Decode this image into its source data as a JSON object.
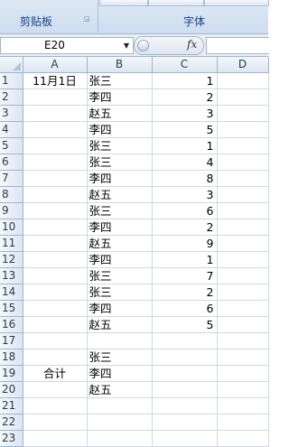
{
  "ribbon": {
    "clipboard_label": "剪贴板",
    "font_label": "字体",
    "launcher_icon": "dialog-launcher-icon"
  },
  "formula_bar": {
    "name_box": "E20",
    "fx_label": "fx",
    "formula": ""
  },
  "sheet": {
    "columns": [
      "A",
      "B",
      "C",
      "D"
    ],
    "rows": [
      {
        "n": "1",
        "a": "11月1日",
        "b": "张三",
        "c": "1"
      },
      {
        "n": "2",
        "a": "",
        "b": "李四",
        "c": "2"
      },
      {
        "n": "3",
        "a": "",
        "b": "赵五",
        "c": "3"
      },
      {
        "n": "4",
        "a": "",
        "b": "李四",
        "c": "5"
      },
      {
        "n": "5",
        "a": "",
        "b": "张三",
        "c": "1"
      },
      {
        "n": "6",
        "a": "",
        "b": "张三",
        "c": "4"
      },
      {
        "n": "7",
        "a": "",
        "b": "李四",
        "c": "8"
      },
      {
        "n": "8",
        "a": "",
        "b": "赵五",
        "c": "3"
      },
      {
        "n": "9",
        "a": "",
        "b": "张三",
        "c": "6"
      },
      {
        "n": "10",
        "a": "",
        "b": "李四",
        "c": "2"
      },
      {
        "n": "11",
        "a": "",
        "b": "赵五",
        "c": "9"
      },
      {
        "n": "12",
        "a": "",
        "b": "李四",
        "c": "1"
      },
      {
        "n": "13",
        "a": "",
        "b": "张三",
        "c": "7"
      },
      {
        "n": "14",
        "a": "",
        "b": "张三",
        "c": "2"
      },
      {
        "n": "15",
        "a": "",
        "b": "李四",
        "c": "6"
      },
      {
        "n": "16",
        "a": "",
        "b": "赵五",
        "c": "5"
      },
      {
        "n": "17",
        "a": "",
        "b": "",
        "c": ""
      },
      {
        "n": "18",
        "a": "",
        "b": "张三",
        "c": ""
      },
      {
        "n": "19",
        "a": "合计",
        "b": "李四",
        "c": ""
      },
      {
        "n": "20",
        "a": "",
        "b": "赵五",
        "c": ""
      },
      {
        "n": "21",
        "a": "",
        "b": "",
        "c": ""
      },
      {
        "n": "22",
        "a": "",
        "b": "",
        "c": ""
      },
      {
        "n": "23",
        "a": "",
        "b": "",
        "c": ""
      }
    ]
  }
}
